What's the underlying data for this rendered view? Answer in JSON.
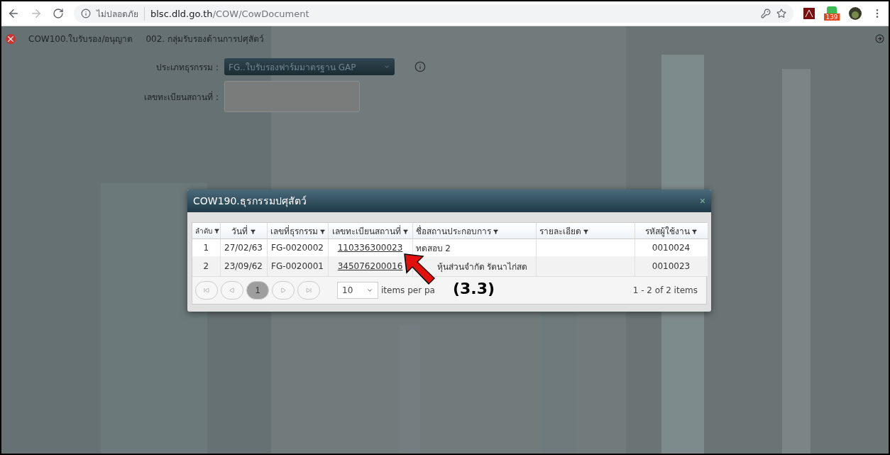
{
  "browser": {
    "security_label": "ไม่ปลอดภัย",
    "url_host": "blsc.dld.go.th",
    "url_path": "/COW/CowDocument",
    "extension_badge": "139"
  },
  "breadcrumb": [
    "COW100.ใบรับรอง/อนุญาต",
    "002. กลุ่มรับรองด้านการปศุสัตว์"
  ],
  "form": {
    "type_label": "ประเภทธุรกรรม :",
    "type_value": "FG..ใบรับรองฟาร์มมาตรฐาน GAP",
    "place_label": "เลขทะเบียนสถานที่ :"
  },
  "dialog": {
    "title": "COW190.ธุรกรรมปศุสัตว์",
    "close": "×",
    "columns": [
      "ลำดับ",
      "วันที่",
      "เลขที่ธุรกรรม",
      "เลขทะเบียนสถานที่",
      "ชื่อสถานประกอบการ",
      "รายละเอียด",
      "รหัสผู้ใช้งาน"
    ],
    "rows": [
      {
        "cells": [
          "1",
          "27/02/63",
          "FG-0020002",
          "110336300023",
          "ทดสอบ 2",
          "",
          "0010024"
        ]
      },
      {
        "cells": [
          "2",
          "23/09/62",
          "FG-0020001",
          "345076200016",
          "หุ้นส่วนจำกัด รัตนาไก่สด",
          "",
          "0010023"
        ]
      }
    ],
    "pager": {
      "pages": [
        {
          "label": "1",
          "selected": true
        }
      ],
      "page_size": "10",
      "page_size_label": "items per pa",
      "summary": "1 - 2 of 2 items"
    }
  },
  "annotation": {
    "label": "(3.3)"
  }
}
